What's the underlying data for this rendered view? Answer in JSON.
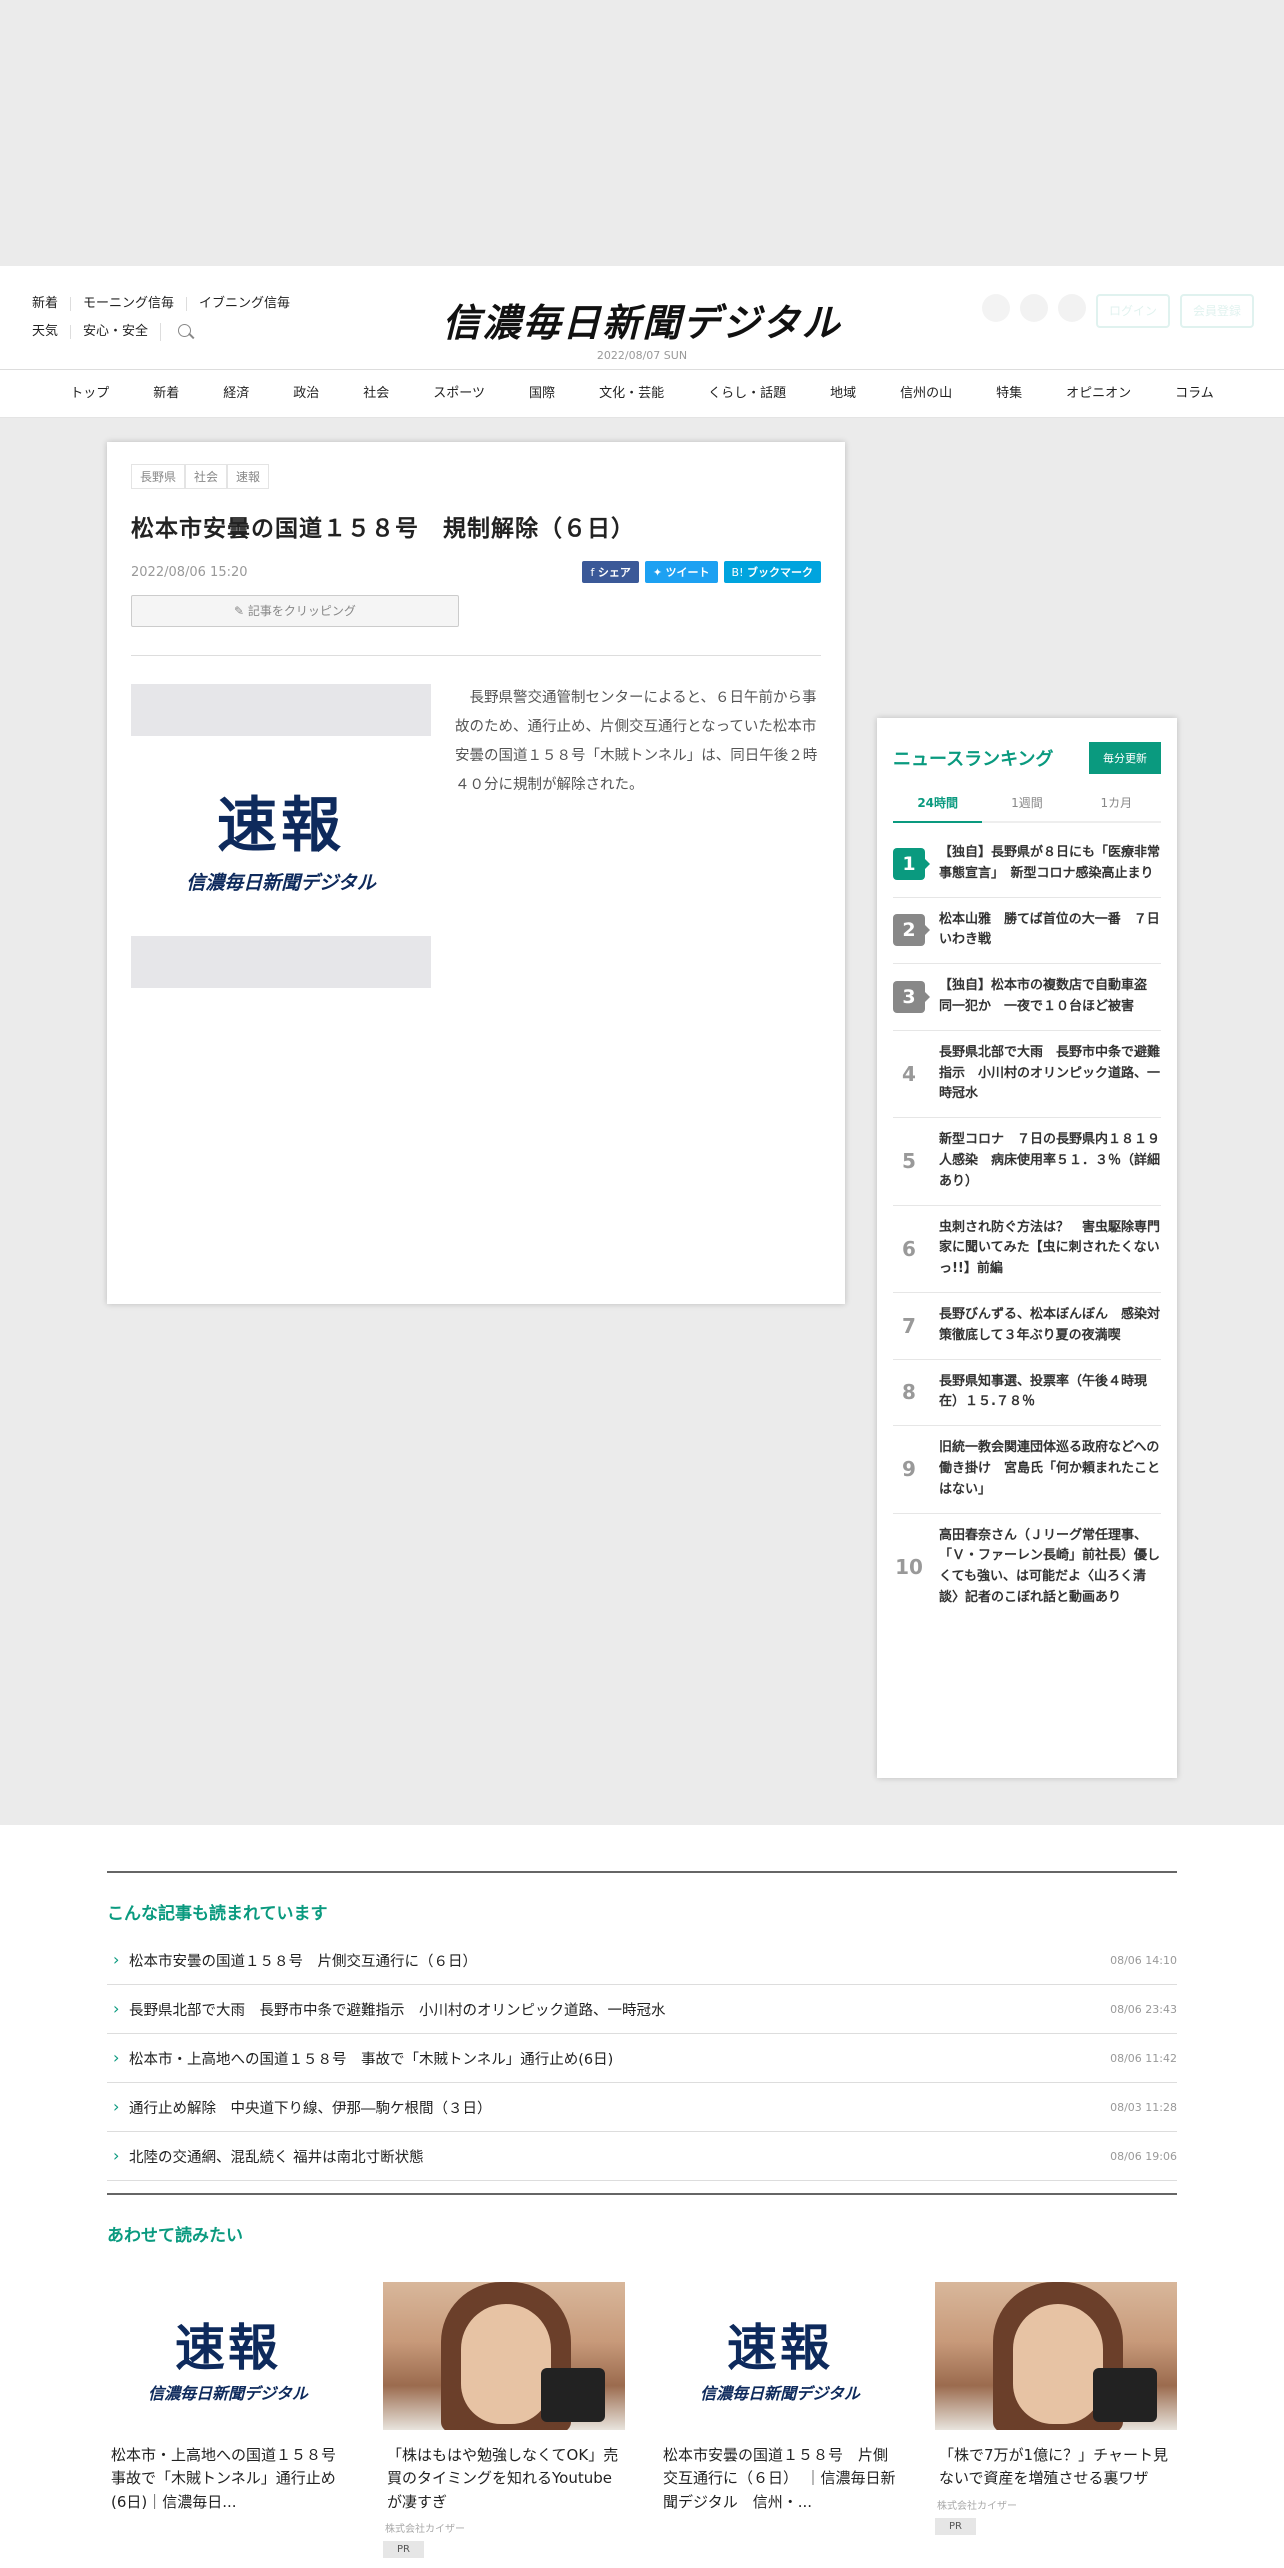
{
  "header": {
    "util_row1": [
      "新着",
      "モーニング信毎",
      "イブニング信毎"
    ],
    "util_row2": [
      "天気",
      "安心・安全"
    ],
    "logo": "信濃毎日新聞デジタル",
    "date": "2022/08/07 SUN",
    "login": "ログイン",
    "register": "会員登録"
  },
  "nav": [
    "トップ",
    "新着",
    "経済",
    "政治",
    "社会",
    "スポーツ",
    "国際",
    "文化・芸能",
    "くらし・話題",
    "地域",
    "信州の山",
    "特集",
    "オピニオン",
    "コラム"
  ],
  "article": {
    "tags": [
      "長野県",
      "社会",
      "速報"
    ],
    "title": "松本市安曇の国道１５８号　規制解除（６日）",
    "date": "2022/08/06 15:20",
    "share_fb": "シェア",
    "share_tw": "ツイート",
    "share_hb": "ブックマーク",
    "clip": "記事をクリッピング",
    "image_big": "速報",
    "image_small": "信濃毎日新聞デジタル",
    "body": "長野県警交通管制センターによると、６日午前から事故のため、通行止め、片側交互通行となっていた松本市安曇の国道１５８号「木賊トンネル」は、同日午後２時４０分に規制が解除された。"
  },
  "ranking": {
    "title": "ニュースランキング",
    "badge": "毎分更新",
    "tabs": [
      "24時間",
      "1週間",
      "1カ月"
    ],
    "items": [
      {
        "num": "1",
        "text": "【独自】長野県が８日にも「医療非常事態宣言」　新型コロナ感染高止まり"
      },
      {
        "num": "2",
        "text": "松本山雅　勝てば首位の大一番　７日いわき戦"
      },
      {
        "num": "3",
        "text": "【独自】松本市の複数店で自動車盗　同一犯か　一夜で１０台ほど被害"
      },
      {
        "num": "4",
        "text": "長野県北部で大雨　長野市中条で避難指示　小川村のオリンピック道路、一時冠水"
      },
      {
        "num": "5",
        "text": "新型コロナ　７日の長野県内１８１９人感染　病床使用率５１．３％（詳細あり）"
      },
      {
        "num": "6",
        "text": "虫刺され防ぐ方法は？　害虫駆除専門家に聞いてみた【虫に刺されたくないっ!!】前編"
      },
      {
        "num": "7",
        "text": "長野びんずる、松本ぼんぼん　感染対策徹底して３年ぶり夏の夜満喫"
      },
      {
        "num": "8",
        "text": "長野県知事選、投票率（午後４時現在）１５.７８％"
      },
      {
        "num": "9",
        "text": "旧統一教会関連団体巡る政府などへの働き掛け　宮島氏「何か頼まれたことはない」"
      },
      {
        "num": "10",
        "text": "高田春奈さん（Ｊリーグ常任理事、「Ｖ・ファーレン長崎」前社長）優しくても強い、は可能だよ〈山ろく清談〉記者のこぼれ話と動画あり"
      }
    ]
  },
  "related": {
    "title": "こんな記事も読まれています",
    "items": [
      {
        "text": "松本市安曇の国道１５８号　片側交互通行に（６日）",
        "date": "08/06 14:10"
      },
      {
        "text": "長野県北部で大雨　長野市中条で避難指示　小川村のオリンピック道路、一時冠水",
        "date": "08/06 23:43"
      },
      {
        "text": "松本市・上高地への国道１５８号　事故で「木賊トンネル」通行止め(6日)",
        "date": "08/06 11:42"
      },
      {
        "text": "通行止め解除　中央道下り線、伊那―駒ケ根間（３日）",
        "date": "08/03 11:28"
      },
      {
        "text": "北陸の交通網、混乱続く 福井は南北寸断状態",
        "date": "08/06 19:06"
      }
    ]
  },
  "recommend": {
    "title": "あわせて読みたい",
    "cards": [
      {
        "title": "松本市・上高地への国道１５８号　事故で「木賊トンネル」通行止め(6日)｜信濃毎日...",
        "sponsor": "",
        "pr": ""
      },
      {
        "title": "「株はもはや勉強しなくてOK」売買のタイミングを知れるYoutubeが凄すぎ",
        "sponsor": "株式会社カイザー",
        "pr": "PR"
      },
      {
        "title": "松本市安曇の国道１５８号　片側交互通行に（６日）　｜信濃毎日新聞デジタル　信州・...",
        "sponsor": "",
        "pr": ""
      },
      {
        "title": "「株で7万が1億に？」チャート見ないで資産を増殖させる裏ワザ",
        "sponsor": "株式会社カイザー",
        "pr": "PR"
      }
    ]
  }
}
